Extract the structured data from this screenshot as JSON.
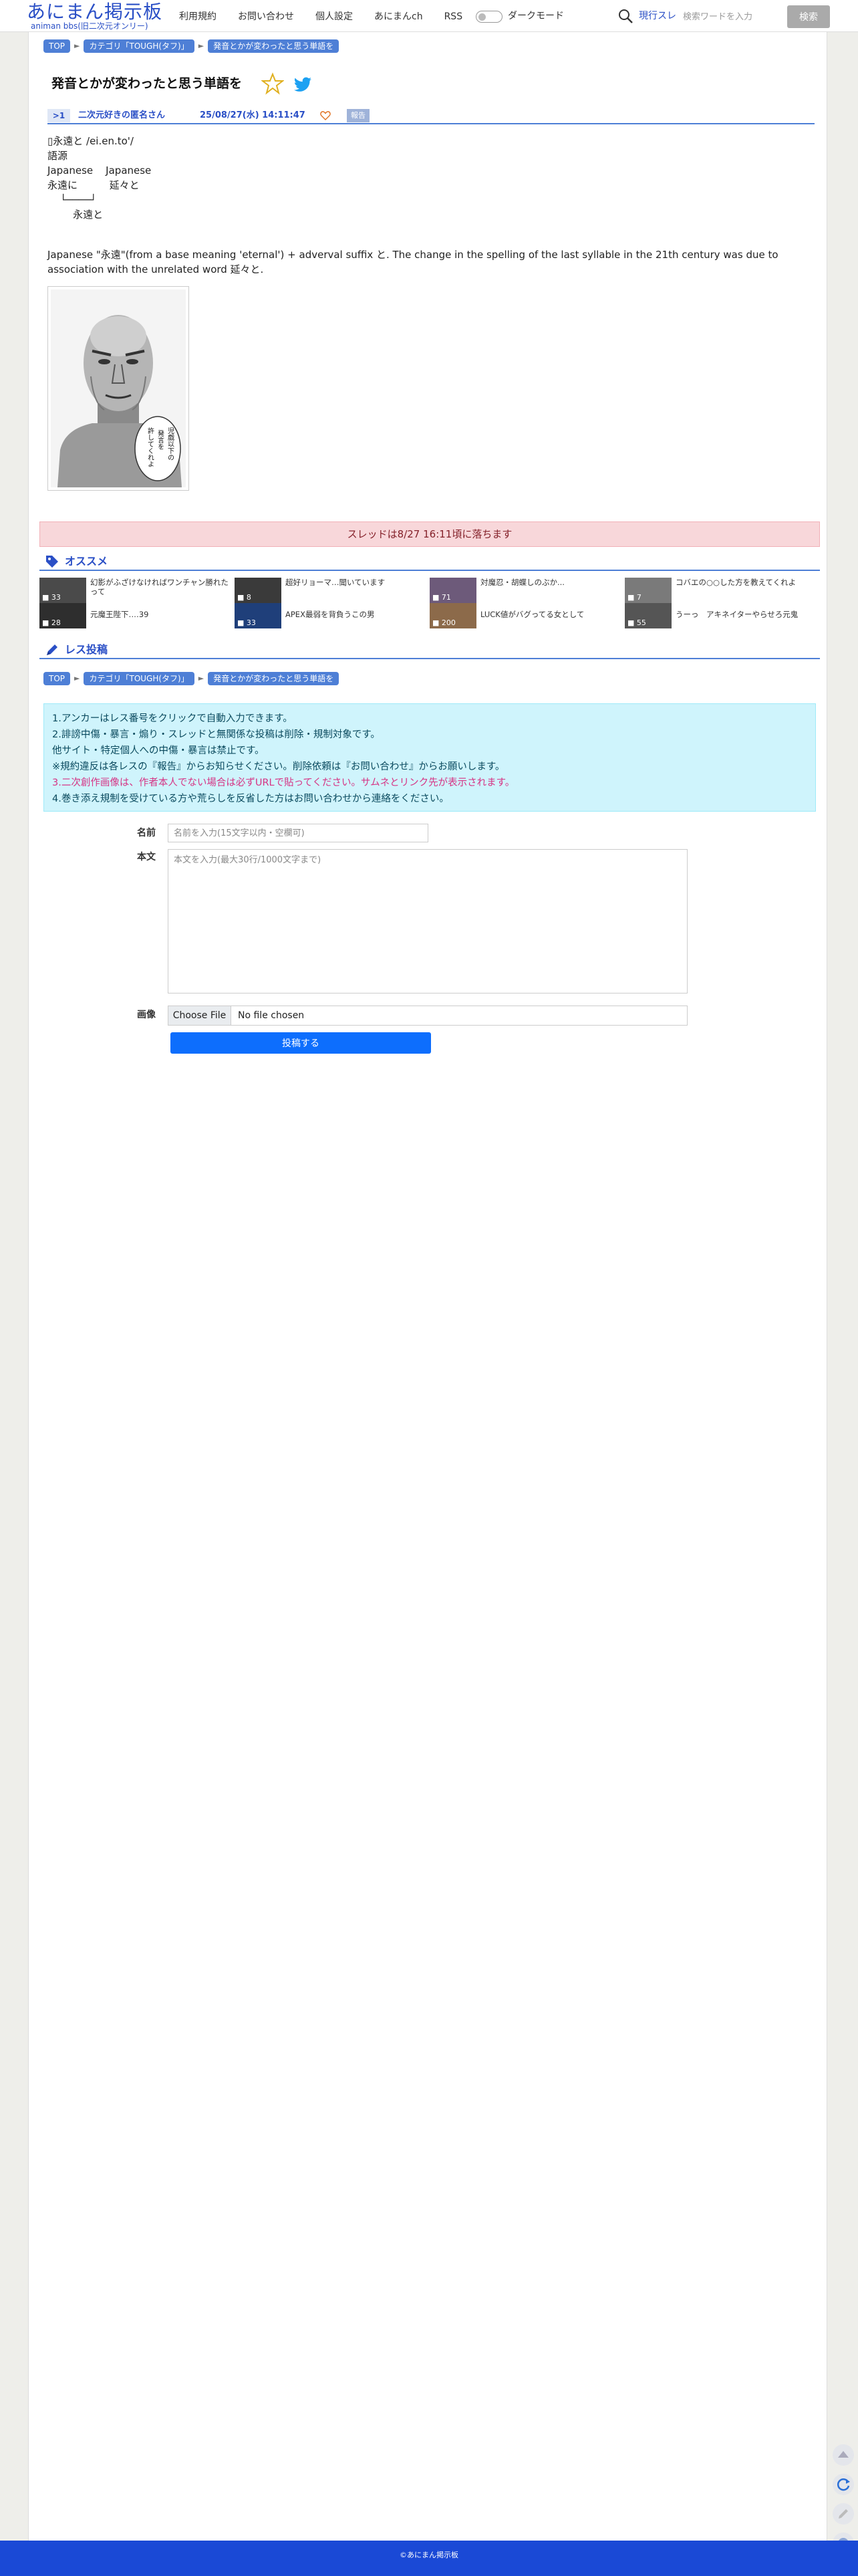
{
  "header": {
    "logo_title": "あにまん掲示板",
    "logo_sub": "animan bbs(旧二次元オンリー)",
    "nav": [
      "利用規約",
      "お問い合わせ",
      "個人設定",
      "あにまんch",
      "RSS"
    ],
    "dark_mode_label": "ダークモード",
    "search_current": "現行スレ",
    "search_placeholder": "検索ワードを入力",
    "search_button": "検索"
  },
  "breadcrumb": [
    "TOP",
    "カテゴリ「TOUGH(タフ)」",
    "発音とかが変わったと思う単語を"
  ],
  "thread": {
    "title": "発音とかが変わったと思う単語を",
    "post": {
      "number": ">1",
      "author": "二次元好きの匿名さん",
      "date": "25/08/27(水) 14:11:47",
      "report": "報告",
      "etymology": [
        "▯永遠と /ei.en.to'/",
        "語源",
        "Japanese    Japanese",
        "永遠に          延々と",
        "    └────┘",
        "        永遠と"
      ],
      "description": "Japanese \"永遠\"(from a base meaning 'eternal') + adverval suffix と. The change in the spelling of the last syllable in the 21th century was due to association with the unrelated word 延々と.",
      "image_speech": [
        "児戯以下の",
        "発言を",
        "許してくれよ"
      ]
    }
  },
  "expired_notice": "スレッドは8/27 16:11頃に落ちます",
  "recommend": {
    "title": "オススメ",
    "items": [
      {
        "title": "幻影がふざけなければワンチャン勝れたって",
        "count": "33"
      },
      {
        "title": "超好リョーマ…聞いています",
        "count": "8"
      },
      {
        "title": "対魔忍・胡蝶しのぶか...",
        "count": "71"
      },
      {
        "title": "コバエの○○した方を教えてくれよ",
        "count": "7"
      },
      {
        "title": "元魔王陛下‥‥39",
        "count": "28"
      },
      {
        "title": "APEX最弱を背負うこの男",
        "count": "33"
      },
      {
        "title": "LUCK値がバグってる女として",
        "count": "200"
      },
      {
        "title": "うーっ　アキネイターやらせろ元鬼",
        "count": "55"
      }
    ]
  },
  "reply": {
    "title": "レス投稿",
    "notice": [
      "1.アンカーはレス番号をクリックで自動入力できます。",
      "2.誹謗中傷・暴言・煽り・スレッドと無関係な投稿は削除・規制対象です。",
      "   他サイト・特定個人への中傷・暴言は禁止です。",
      "※規約違反は各レスの『報告』からお知らせください。削除依頼は『お問い合わせ』からお願いします。",
      "3.二次創作画像は、作者本人でない場合は必ずURLで貼ってください。サムネとリンク先が表示されます。",
      "4.巻き添え規制を受けている方や荒らしを反省した方はお問い合わせから連絡をください。"
    ],
    "name_label": "名前",
    "name_placeholder": "名前を入力(15文字以内・空欄可)",
    "body_label": "本文",
    "body_placeholder": "本文を入力(最大30行/1000文字まで)",
    "image_label": "画像",
    "file_button": "Choose File",
    "file_status": "No file chosen",
    "submit": "投稿する"
  },
  "footer": "©あにまん掲示板",
  "colors": {
    "brand": "#2a4fc6",
    "crumb": "#4e7fd6",
    "footer": "#1a49d6",
    "submit": "#0d6efd"
  }
}
